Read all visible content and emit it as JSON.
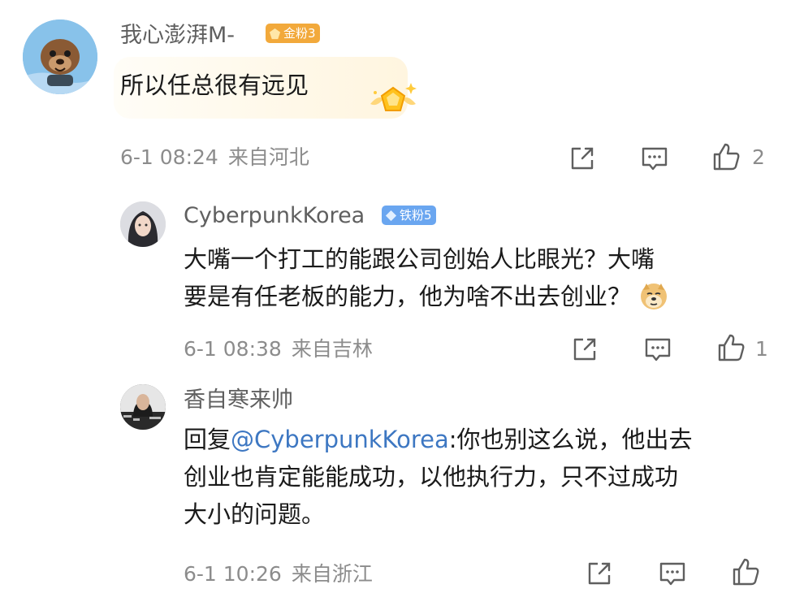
{
  "comments": [
    {
      "username": "我心澎湃M-",
      "badge": "金粉3",
      "text": "所以任总很有远见",
      "time": "6-1 08:24",
      "location": "来自河北",
      "likes": "2",
      "colors": {
        "badge": "#f2a93b"
      }
    },
    {
      "username": "CyberpunkKorea",
      "badge": "铁粉5",
      "text_line1": "大嘴一个打工的能跟公司创始人比眼光？大嘴",
      "text_line2": "要是有任老板的能力，他为啥不出去创业？",
      "time": "6-1 08:38",
      "location": "来自吉林",
      "likes": "1",
      "colors": {
        "badge": "#6aa6f0"
      }
    },
    {
      "username": "香自寒来帅",
      "reply_prefix": "回复",
      "mention": "@CyberpunkKorea",
      "text_line1_rest": ":你也别这么说，他出去",
      "text_line2": "创业也肯定能能成功，以他执行力，只不过成功",
      "text_line3": "大小的问题。",
      "time": "6-1 10:26",
      "location": "来自浙江",
      "likes": ""
    }
  ],
  "icons": [
    "share-icon",
    "comment-icon",
    "like-icon",
    "doge-emoji",
    "sparkle-badge-icon"
  ]
}
